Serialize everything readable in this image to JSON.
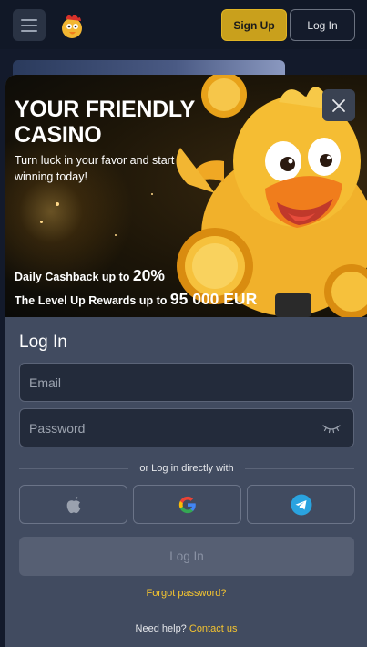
{
  "header": {
    "signup_label": "Sign Up",
    "login_label": "Log In"
  },
  "banner": {
    "title": "YOUR FRIENDLY CASINO",
    "subtitle": "Turn luck in your favor and start winning today!",
    "promo_1_text": "Daily Cashback up to",
    "promo_1_value": "20%",
    "promo_2_text": "The Level Up Rewards up to",
    "promo_2_value": "95 000 EUR"
  },
  "login": {
    "title": "Log In",
    "email_placeholder": "Email",
    "password_placeholder": "Password",
    "divider_text": "or Log in directly with",
    "submit_label": "Log In",
    "forgot_label": "Forgot password?",
    "help_text": "Need help?",
    "help_link": "Contact us"
  },
  "colors": {
    "accent": "#f4c430",
    "signup_bg": "#c9a01c",
    "panel_bg": "#414b60",
    "input_bg": "#232b3b"
  },
  "icons": [
    "hamburger-icon",
    "rooster-logo",
    "close-icon",
    "eye-off-icon",
    "apple-icon",
    "google-icon",
    "telegram-icon"
  ]
}
